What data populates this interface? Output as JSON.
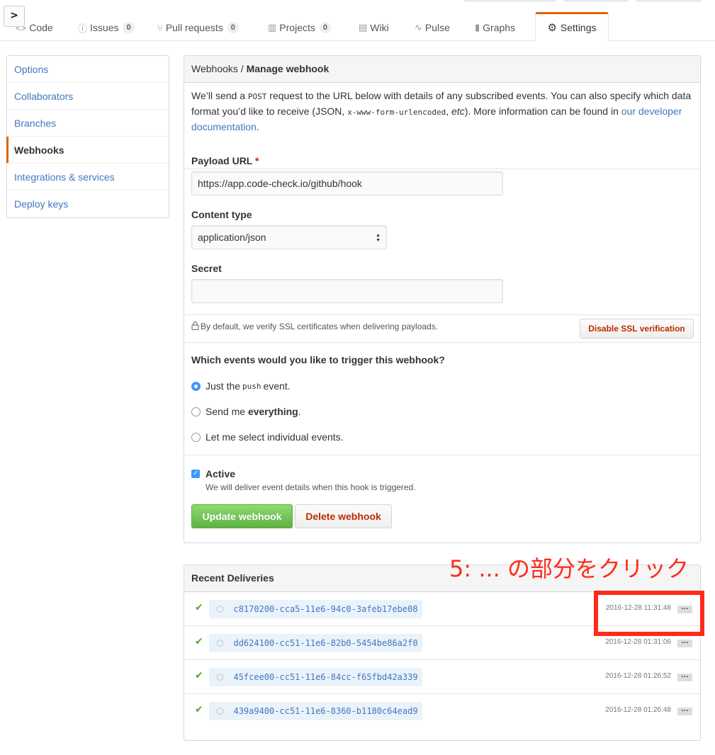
{
  "expand_symbol": ">",
  "nav": {
    "tabs": [
      {
        "label": "Code",
        "icon": "code-icon",
        "glyph": "<>"
      },
      {
        "label": "Issues",
        "icon": "issue-opened-icon",
        "glyph": "ⓘ",
        "count": "0"
      },
      {
        "label": "Pull requests",
        "icon": "git-pull-request-icon",
        "glyph": "⑂",
        "count": "0"
      },
      {
        "label": "Projects",
        "icon": "project-icon",
        "glyph": "▥",
        "count": "0"
      },
      {
        "label": "Wiki",
        "icon": "book-icon",
        "glyph": "▤"
      },
      {
        "label": "Pulse",
        "icon": "pulse-icon",
        "glyph": "∿"
      },
      {
        "label": "Graphs",
        "icon": "graph-icon",
        "glyph": "▮"
      }
    ],
    "selected": {
      "label": "Settings",
      "icon": "gear-icon",
      "glyph": "⚙"
    }
  },
  "sidebar": {
    "items": [
      {
        "label": "Options",
        "selected": false
      },
      {
        "label": "Collaborators",
        "selected": false
      },
      {
        "label": "Branches",
        "selected": false
      },
      {
        "label": "Webhooks",
        "selected": true
      },
      {
        "label": "Integrations & services",
        "selected": false
      },
      {
        "label": "Deploy keys",
        "selected": false
      }
    ]
  },
  "webhook": {
    "breadcrumb_parent": "Webhooks",
    "breadcrumb_sep": " / ",
    "breadcrumb_current": "Manage webhook",
    "intro": {
      "t1": "We’ll send a ",
      "post": "POST",
      "t2": " request to the URL below with details of any subscribed events. You can also specify which data format you’d like to receive (JSON, ",
      "form": "x-www-form-urlencoded",
      "t3": ", ",
      "etc": "etc",
      "t4": "). More information can be found in ",
      "link": "our developer documentation",
      "t5": "."
    },
    "payload_label": "Payload URL",
    "required_mark": "*",
    "payload_value": "https://app.code-check.io/github/hook",
    "content_type_label": "Content type",
    "content_type_value": "application/json",
    "select_arrows": "▲▼",
    "secret_label": "Secret",
    "secret_value": "",
    "ssl_note": "By default, we verify SSL certificates when delivering payloads.",
    "ssl_button": "Disable SSL verification",
    "events_question": "Which events would you like to trigger this webhook?",
    "event_push": {
      "pre": "Just the ",
      "code": "push",
      "post": " event."
    },
    "event_all": {
      "pre": "Send me ",
      "bold": "everything",
      "post": "."
    },
    "event_individual": "Let me select individual events.",
    "selected_event": "push",
    "active_checked": true,
    "check_glyph": "✓",
    "active_label": "Active",
    "active_note": "We will deliver event details when this hook is triggered.",
    "update_button": "Update webhook",
    "delete_button": "Delete webhook"
  },
  "deliveries": {
    "title": "Recent Deliveries",
    "ok_glyph": "✔",
    "package_glyph": "⬡",
    "ellipsis_glyph": "...",
    "items": [
      {
        "guid": "c8170200-cca5-11e6-94c0-3afeb17ebe08",
        "timestamp": "2016-12-28 11:31:48",
        "status": "success"
      },
      {
        "guid": "dd624100-cc51-11e6-82b0-5454be86a2f0",
        "timestamp": "2016-12-28 01:31:06",
        "status": "success"
      },
      {
        "guid": "45fcee00-cc51-11e6-84cc-f65fbd42a339",
        "timestamp": "2016-12-28 01:26:52",
        "status": "success"
      },
      {
        "guid": "439a9400-cc51-11e6-8360-b1180c64ead9",
        "timestamp": "2016-12-28 01:26:48",
        "status": "success"
      }
    ]
  },
  "annotation": {
    "text": "5: ...  の部分をクリック",
    "color": "#ff2a1a"
  },
  "colors": {
    "link": "#4078c0",
    "selected_tab_accent": "#e36209",
    "danger": "#bd2c00",
    "primary_green": "#60b044",
    "radio_blue": "#3b99fc"
  }
}
